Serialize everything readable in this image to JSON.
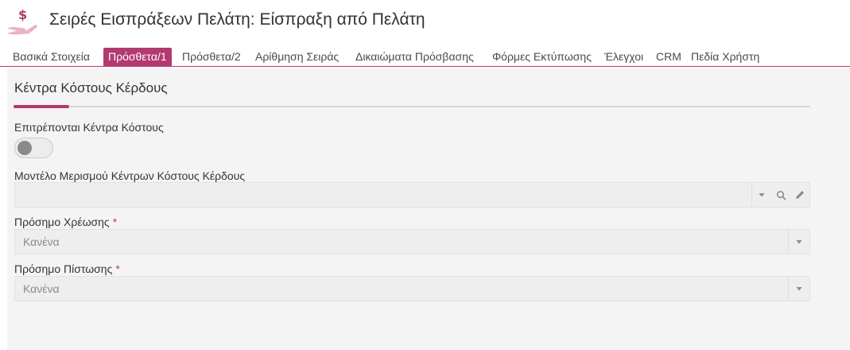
{
  "header": {
    "title": "Σειρές Εισπράξεων Πελάτη: Είσπραξη από Πελάτη",
    "logo_icon": "hand-dollar-icon",
    "accent_color": "#b23a6f"
  },
  "tabs": [
    {
      "label": "Βασικά Στοιχεία",
      "active": false
    },
    {
      "label": "Πρόσθετα/1",
      "active": true
    },
    {
      "label": "Πρόσθετα/2",
      "active": false
    },
    {
      "label": "Αρίθμηση Σειράς",
      "active": false
    },
    {
      "label": "Δικαιώματα Πρόσβασης",
      "active": false
    },
    {
      "label": "Φόρμες Εκτύπωσης",
      "active": false
    },
    {
      "label": "Έλεγχοι",
      "active": false
    },
    {
      "label": "CRM",
      "active": false
    },
    {
      "label": "Πεδία Χρήστη",
      "active": false
    }
  ],
  "section": {
    "title": "Κέντρα Κόστους Κέρδους"
  },
  "fields": {
    "allow_cost_centers": {
      "label": "Επιτρέπονται Κέντρα Κόστους",
      "on": false
    },
    "distribution_model": {
      "label": "Μοντέλο Μερισμού Κέντρων Κόστους Κέρδους",
      "value": ""
    },
    "debit_sign": {
      "label": "Πρόσημο Χρέωσης",
      "required_mark": "*",
      "value": "Κανένα"
    },
    "credit_sign": {
      "label": "Πρόσημο Πίστωσης",
      "required_mark": "*",
      "value": "Κανένα"
    }
  }
}
